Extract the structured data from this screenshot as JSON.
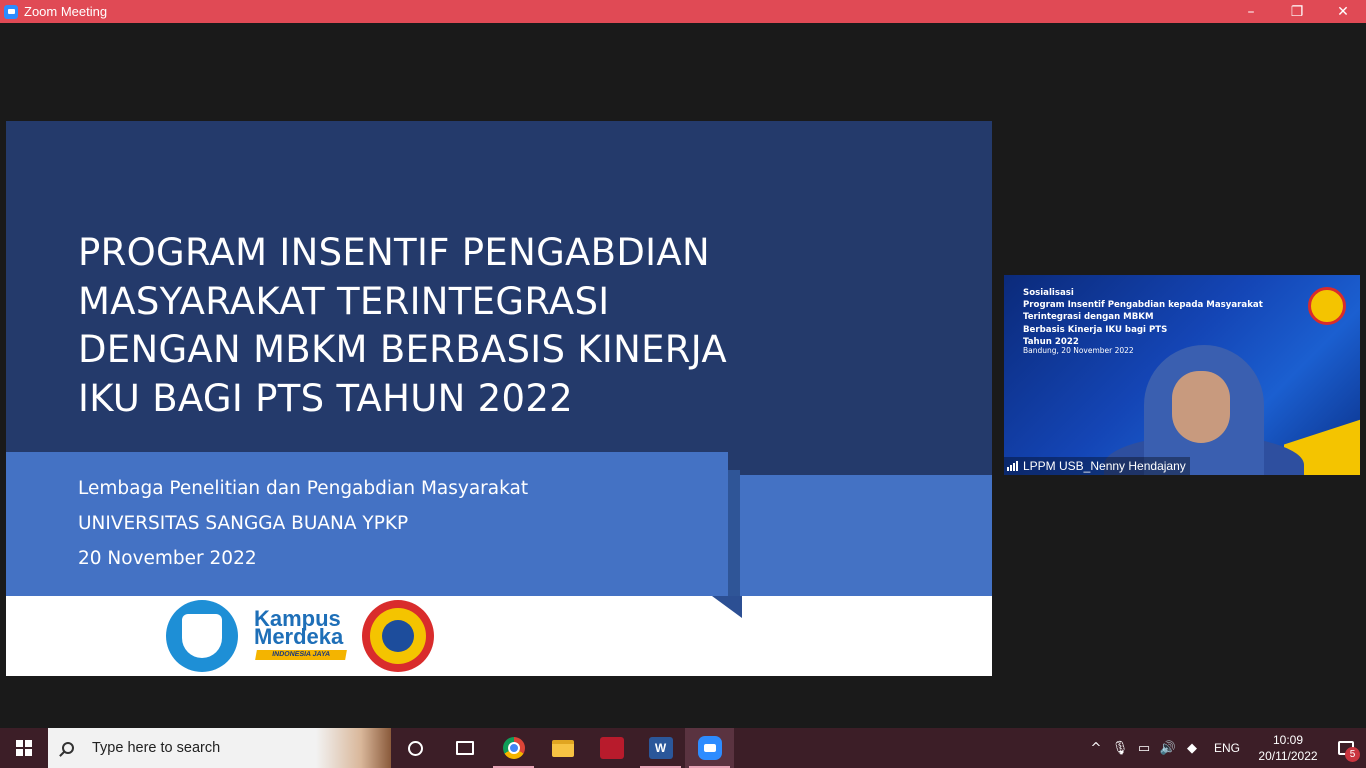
{
  "window": {
    "title": "Zoom Meeting",
    "controls": {
      "minimize": "–",
      "restore": "❐",
      "close": "✕"
    }
  },
  "slide": {
    "title_lines": [
      "PROGRAM INSENTIF PENGABDIAN",
      "MASYARAKAT TERINTEGRASI",
      "DENGAN MBKM BERBASIS KINERJA",
      "IKU BAGI PTS TAHUN 2022"
    ],
    "subtitle_lines": [
      "Lembaga Penelitian dan Pengabdian Masyarakat",
      "UNIVERSITAS SANGGA BUANA YPKP",
      "20 November 2022"
    ],
    "logos": {
      "kampus_merdeka_top": "Kampus",
      "kampus_merdeka_bottom": "Merdeka",
      "kampus_merdeka_tag": "INDONESIA JAYA"
    },
    "colors": {
      "dark_blue": "#243a6b",
      "band_blue": "#4472c4"
    }
  },
  "participant": {
    "background_lines": [
      "Sosialisasi",
      "Program Insentif Pengabdian kepada Masyarakat",
      "Terintegrasi dengan MBKM",
      "Berbasis Kinerja IKU bagi PTS",
      "Tahun 2022"
    ],
    "background_date": "Bandung, 20 November 2022",
    "name": "LPPM USB_Nenny Hendajany"
  },
  "taskbar": {
    "search_placeholder": "Type here to search",
    "apps": [
      "cortana-icon",
      "task-view-icon",
      "chrome-icon",
      "file-explorer-icon",
      "mendeley-icon",
      "word-icon",
      "zoom-icon"
    ],
    "word_letter": "W",
    "tray": {
      "chevron": "^",
      "language": "ENG",
      "time": "10:09",
      "date": "20/11/2022",
      "notification_count": "5"
    }
  }
}
